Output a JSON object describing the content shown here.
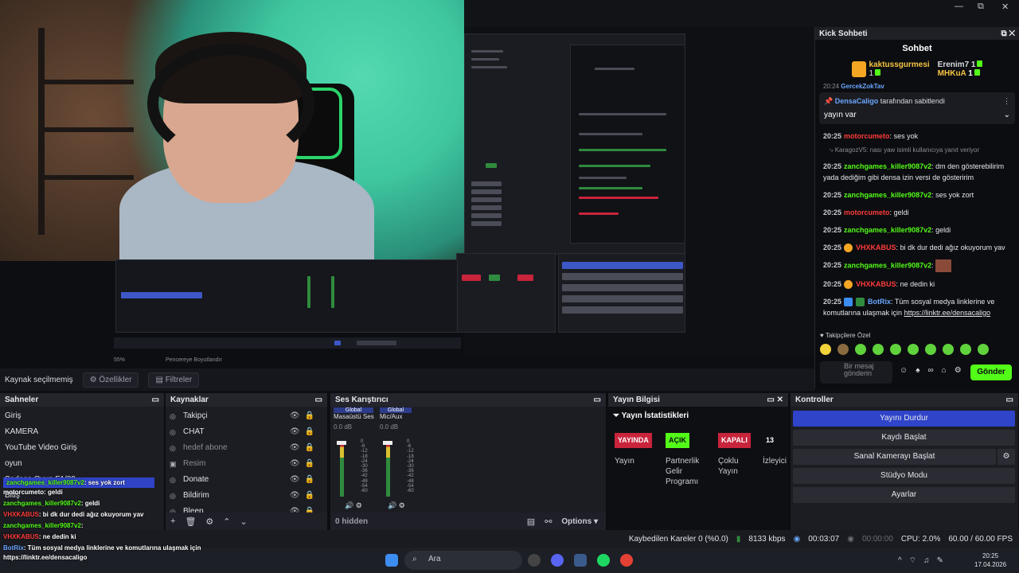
{
  "window": {
    "minimize": "—",
    "maximize": "⧉",
    "close": "✕"
  },
  "chat": {
    "dock_title": "Kick Sohbeti",
    "subtitle": "Sohbet",
    "leaders": [
      {
        "name": "kaktussgurmesi",
        "count": "1",
        "color": "#f5c542"
      },
      {
        "name": "Erenim7",
        "count": "1",
        "color": "#ffffff"
      },
      {
        "name": "MHKuA",
        "count": "1",
        "color": "#f5c542"
      }
    ],
    "pinned": {
      "header_partial": "20:24",
      "header_user": "GercekZokTav",
      "pinned_by_user": "DensaCaligo",
      "pinned_by_text": "tarafından sabitlendi",
      "message": "yayın var"
    },
    "messages": [
      {
        "time": "20:25",
        "user": "motorcumeto",
        "text": "ses yok",
        "color": "red"
      },
      {
        "time": "",
        "user": "KaragozV5",
        "text": "nası yaw isimli kullanıcıya yanıt veriyor",
        "color": "gray"
      },
      {
        "time": "20:25",
        "user": "zanchgames_killer9087v2",
        "text": "dm den gösterebilirim yada dediğim gibi densa izin versi de gösteririm",
        "color": "green"
      },
      {
        "time": "20:25",
        "user": "zanchgames_killer9087v2",
        "text": "ses yok zort",
        "color": "green"
      },
      {
        "time": "20:25",
        "user": "motorcumeto",
        "text": "geldi",
        "color": "red"
      },
      {
        "time": "20:25",
        "user": "zanchgames_killer9087v2",
        "text": "geldi",
        "color": "green"
      },
      {
        "time": "20:25",
        "user": "VHXKABUS",
        "text": "bi dk dur dedi ağız okuyorum yav",
        "color": "redb"
      },
      {
        "time": "20:25",
        "user": "zanchgames_killer9087v2",
        "text": "",
        "color": "green"
      },
      {
        "time": "20:25",
        "user": "VHXKABUS",
        "text": "ne dedin ki",
        "color": "redb"
      },
      {
        "time": "20:25",
        "user": "BotRix",
        "text": "Tüm sosyal medya linklerine ve komutlarına ulaşmak için",
        "link": "https://linktr.ee/densacaligo",
        "color": "blue"
      }
    ],
    "followers_label": "Takipçilere Özel",
    "input_placeholder": "Bir mesaj gönderin",
    "send_label": "Gönder"
  },
  "source_bar": {
    "none_selected": "Kaynak seçilmemiş",
    "properties": "Özellikler",
    "filters": "Filtreler"
  },
  "scenes": {
    "title": "Sahneler",
    "items": [
      "Giriş",
      "KAMERA",
      "YouTube Video Giriş",
      "oyun",
      "Sadece Oyun F1/09",
      "Bitiş"
    ]
  },
  "sources": {
    "title": "Kaynaklar",
    "items": [
      "Takipçi",
      "CHAT",
      "hedef abone",
      "Resim",
      "Donate",
      "Bildirim",
      "Bleep"
    ]
  },
  "mixer": {
    "title": "Ses Karıştırıcı",
    "channels": [
      {
        "tag": "Global",
        "name": "Masaüstü Ses",
        "db": "0.0 dB"
      },
      {
        "tag": "Global",
        "name": "Mic/Aux",
        "db": "0.0 dB"
      }
    ],
    "scale": [
      "0",
      "-6",
      "-12",
      "-18",
      "-24",
      "-30",
      "-36",
      "-42",
      "-48",
      "-54",
      "-60"
    ],
    "hidden": "0 hidden",
    "options": "Options"
  },
  "stream_info": {
    "title": "Yayın Bilgisi",
    "header": "Yayın İstatistikleri",
    "stats": [
      {
        "pill": "YAYINDA",
        "label": "Yayın",
        "color": "#c8243c"
      },
      {
        "pill": "AÇIK",
        "label": "Partnerlik Gelir Programı",
        "color": "#53fc18"
      },
      {
        "pill": "KAPALI",
        "label": "Çoklu Yayın",
        "color": "#c8243c"
      },
      {
        "pill": "13",
        "label": "İzleyici",
        "color": "transparent"
      }
    ]
  },
  "controls": {
    "title": "Kontroller",
    "buttons": [
      "Yayını Durdur",
      "Kaydı Başlat",
      "Sanal Kamerayı Başlat",
      "Stüdyo Modu",
      "Ayarlar"
    ]
  },
  "status": {
    "dropped": "Kaybedilen Kareler 0 (%0.0)",
    "bitrate": "8133 kbps",
    "stream_time": "00:03:07",
    "rec_time": "00:00:00",
    "cpu": "CPU: 2.0%",
    "fps": "60.00 / 60.00 FPS"
  },
  "taskbar": {
    "search": "Ara",
    "time": "20:25",
    "date": "17.04.2026"
  },
  "overlay": [
    {
      "user": "zanchgames_killer9087v2",
      "text": ": ses yok zort"
    },
    {
      "user": "motorcumeto",
      "text": ": geldi"
    },
    {
      "user": "zanchgames_killer9087v2",
      "text": ": geldi"
    },
    {
      "user": "VHXKABUS",
      "text": ": bi dk dur dedi ağız okuyorum yav"
    },
    {
      "user": "zanchgames_killer9087v2",
      "text": ":"
    },
    {
      "user": "VHXKABUS",
      "text": ": ne dedin ki"
    },
    {
      "user": "BotRix",
      "text": ": Tüm sosyal medya linklerine ve komutlarına ulaşmak için"
    },
    {
      "user": "",
      "text": "https://linktr.ee/densacaligo"
    }
  ],
  "preview": {
    "zoom": "55%",
    "fit": "Pencereye Boyutlandır"
  }
}
